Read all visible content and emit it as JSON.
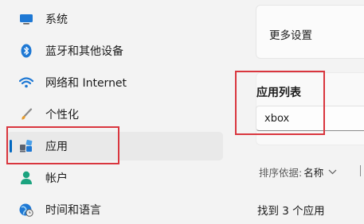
{
  "sidebar": {
    "items": [
      {
        "label": "系统",
        "icon": "monitor-icon"
      },
      {
        "label": "蓝牙和其他设备",
        "icon": "bluetooth-icon"
      },
      {
        "label": "网络和 Internet",
        "icon": "wifi-icon"
      },
      {
        "label": "个性化",
        "icon": "brush-icon"
      },
      {
        "label": "应用",
        "icon": "apps-icon",
        "selected": true
      },
      {
        "label": "帐户",
        "icon": "person-icon"
      },
      {
        "label": "时间和语言",
        "icon": "globe-clock-icon"
      }
    ]
  },
  "main": {
    "more_settings_label": "更多设置",
    "app_list_title": "应用列表",
    "search_value": "xbox",
    "sort_label": "排序依据:",
    "sort_value": "名称",
    "found_text": "找到 3 个应用"
  },
  "colors": {
    "accent": "#0067c0",
    "highlight_box": "#d9363e"
  }
}
